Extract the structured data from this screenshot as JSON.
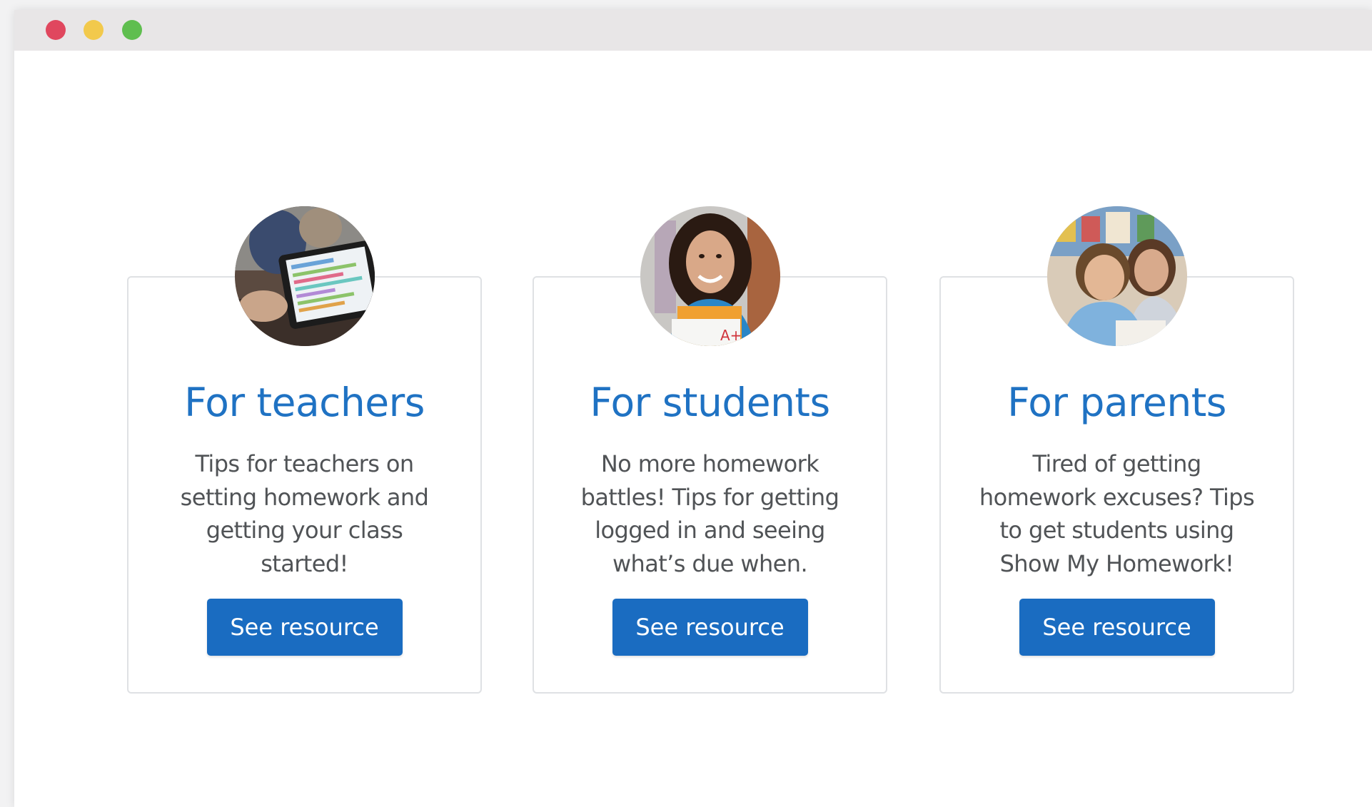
{
  "cards": [
    {
      "title": "For teachers",
      "description": "Tips for teachers on setting homework and getting your class started!",
      "button_label": "See resource",
      "image": "teacher-tablet-photo"
    },
    {
      "title": "For students",
      "description": "No more homework battles! Tips for getting logged in and seeing what’s due when.",
      "button_label": "See resource",
      "image": "student-smiling-photo"
    },
    {
      "title": "For parents",
      "description": "Tired of getting homework excuses? Tips to get students using Show My Homework!",
      "button_label": "See resource",
      "image": "children-reading-photo"
    }
  ],
  "colors": {
    "accent": "#1f72c3",
    "button": "#1a6cc1",
    "close": "#e0475e",
    "minimize": "#f2c94c",
    "maximize": "#5fbe4f"
  }
}
